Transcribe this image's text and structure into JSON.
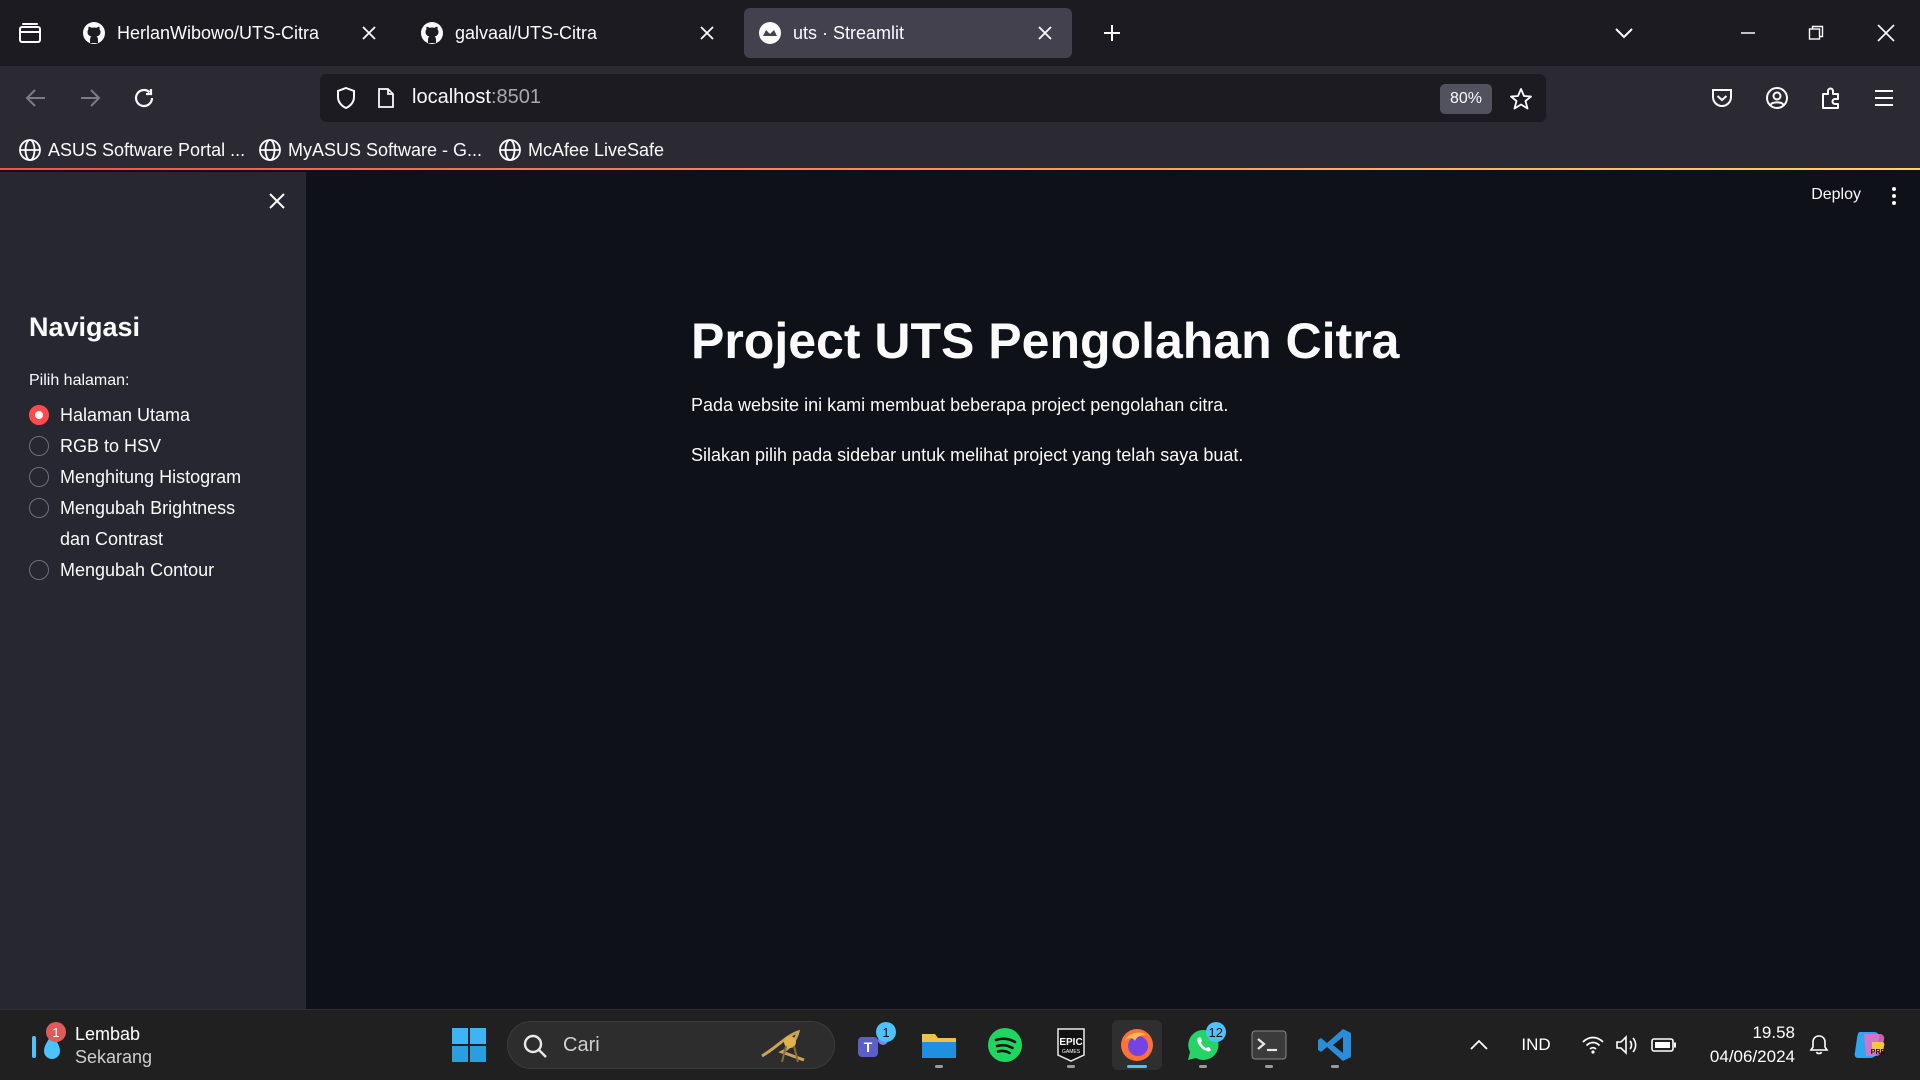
{
  "browser": {
    "tabs": [
      {
        "title": "HerlanWibowo/UTS-Citra",
        "icon": "github-icon",
        "active": false
      },
      {
        "title": "galvaal/UTS-Citra",
        "icon": "github-icon",
        "active": false
      },
      {
        "title": "uts · Streamlit",
        "icon": "streamlit-icon",
        "active": true
      }
    ],
    "url_host": "localhost",
    "url_port": ":8501",
    "zoom": "80%",
    "bookmarks": [
      {
        "label": "ASUS Software Portal ...",
        "icon": "globe-icon"
      },
      {
        "label": "MyASUS Software - G...",
        "icon": "globe-icon"
      },
      {
        "label": "McAfee LiveSafe",
        "icon": "globe-icon"
      }
    ]
  },
  "sidebar": {
    "title": "Navigasi",
    "radio_label": "Pilih halaman:",
    "options": [
      {
        "label": "Halaman Utama",
        "selected": true
      },
      {
        "label": "RGB to HSV",
        "selected": false
      },
      {
        "label": "Menghitung Histogram",
        "selected": false
      },
      {
        "label": "Mengubah Brightness dan Contrast",
        "selected": false
      },
      {
        "label": "Mengubah Contour",
        "selected": false
      }
    ]
  },
  "main": {
    "deploy_label": "Deploy",
    "title": "Project UTS Pengolahan Citra",
    "paragraph1": "Pada website ini kami membuat beberapa project pengolahan citra.",
    "paragraph2": "Silakan pilih pada sidebar untuk melihat project yang telah saya buat."
  },
  "taskbar": {
    "weather_line1": "Lembab",
    "weather_line2": "Sekarang",
    "weather_badge": "1",
    "search_placeholder": "Cari",
    "teams_badge": "1",
    "whatsapp_badge": "12",
    "language": "IND",
    "time": "19.58",
    "date": "04/06/2024"
  },
  "colors": {
    "accent": "#ff4b4b",
    "sidebar_bg": "#262730",
    "app_bg": "#0e1117",
    "taskbar_accent": "#4cc2ff"
  }
}
